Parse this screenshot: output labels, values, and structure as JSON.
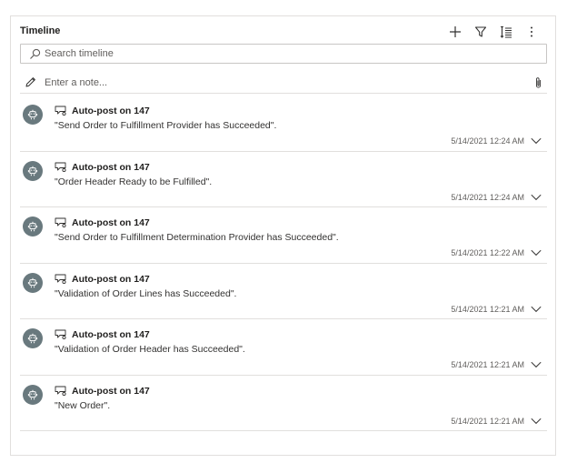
{
  "timeline": {
    "title": "Timeline",
    "toolbar": {
      "add_icon": "plus-icon",
      "filter_icon": "filter-icon",
      "sort_icon": "sort-icon",
      "more_icon": "more-icon"
    },
    "search": {
      "placeholder": "Search timeline",
      "value": ""
    },
    "note": {
      "placeholder": "Enter a note...",
      "value": ""
    },
    "posts": [
      {
        "title": "Auto-post on 147",
        "body": "\"Send Order to Fulfillment Provider has Succeeded\".",
        "time": "5/14/2021 12:24 AM"
      },
      {
        "title": "Auto-post on 147",
        "body": "\"Order Header Ready to be Fulfilled\".",
        "time": "5/14/2021 12:24 AM"
      },
      {
        "title": "Auto-post on 147",
        "body": "\"Send Order to Fulfillment Determination Provider has Succeeded\".",
        "time": "5/14/2021 12:22 AM"
      },
      {
        "title": "Auto-post on 147",
        "body": "\"Validation of Order Lines has Succeeded\".",
        "time": "5/14/2021 12:21 AM"
      },
      {
        "title": "Auto-post on 147",
        "body": "\"Validation of Order Header has Succeeded\".",
        "time": "5/14/2021 12:21 AM"
      },
      {
        "title": "Auto-post on 147",
        "body": "\"New Order\".",
        "time": "5/14/2021 12:21 AM"
      }
    ],
    "colors": {
      "avatar_bg": "#69797e",
      "border": "#e1dfdd",
      "text": "#323130",
      "muted": "#605e5c"
    }
  }
}
